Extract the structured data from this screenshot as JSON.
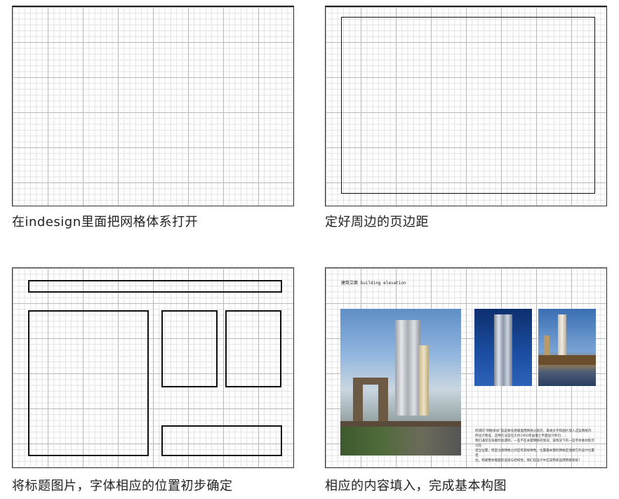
{
  "panels": [
    {
      "caption": "在indesign里面把网格体系打开"
    },
    {
      "caption": "定好周边的页边距"
    },
    {
      "caption": "将标题图片，字体相应的位置初步确定"
    },
    {
      "caption": "相应的内容填入，完成基本构图"
    }
  ],
  "final_layout": {
    "title": "建筑立面 building elevation",
    "body_lines": [
      "所谓的“网格系统”就是要先把版面用网格分割开，再将文字和图片放入这些网格内",
      "所设计而成，这种方法是在大约1950年由瑞士平面设计师们……",
      "我们通常在排版时会遇到，一些不在关键网格的情况，该情况下的一些字体素材就可以在",
      "适当位置，但是注意网格之间应有其规律性，位置最关键的网格是连接它的设计位置定",
      "位，构建整体版面的美感与结构性，我们在设计中应该熟练运用网格系统？"
    ],
    "photos": [
      "brooklyn-bridge-photo",
      "tower-night-photo",
      "skyline-photo"
    ]
  }
}
